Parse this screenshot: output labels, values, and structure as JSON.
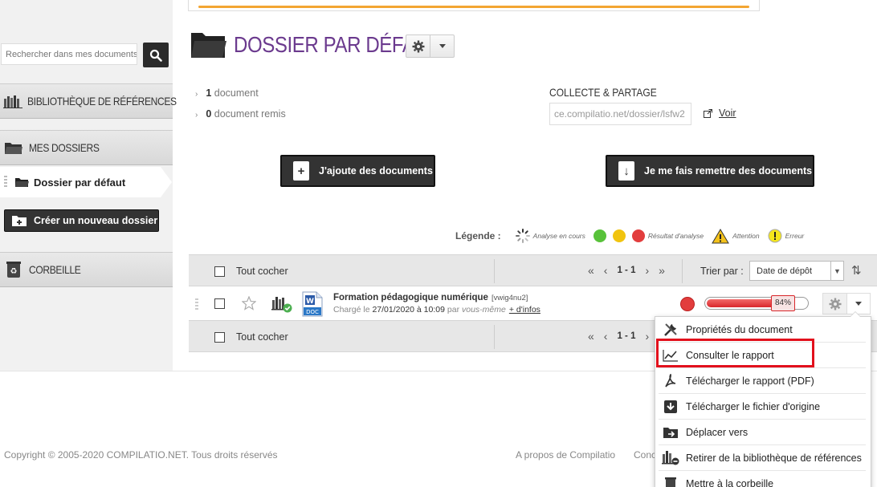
{
  "colors": {
    "title": "#6b3a8e",
    "dark_button": "#333333",
    "red": "#e23d3d",
    "green": "#58c23a",
    "yellow": "#f1c40f",
    "highlight": "#e2101c"
  },
  "sidebar": {
    "search_placeholder": "Rechercher dans mes documents",
    "search_icon": "magnifier-icon",
    "library_label": "Bibliothèque de références",
    "my_folders_label": "Mes dossiers",
    "active_folder_label": "Dossier par défaut",
    "new_folder_label": "Créer un nouveau dossier",
    "trash_label": "Corbeille"
  },
  "header": {
    "title": "DOSSIER PAR DÉFAUT",
    "stats": [
      {
        "count": "1",
        "text": "document"
      },
      {
        "count": "0",
        "text": "document remis"
      }
    ],
    "collect_title": "COLLECTE & PARTAGE",
    "collect_url": "ce.compilatio.net/dossier/lsfw2",
    "voir_label": "Voir"
  },
  "actions": {
    "add_docs": "J'ajoute des documents",
    "request_docs": "Je me fais remettre des documents"
  },
  "legend": {
    "title": "Légende :",
    "analyzing": "Analyse en cours",
    "result": "Résultat d'analyse",
    "warning": "Attention",
    "error": "Erreur"
  },
  "list": {
    "select_all": "Tout cocher",
    "page_range": "1 - 1",
    "sort_label": "Trier par :",
    "sort_value": "Date de dépôt"
  },
  "document": {
    "title": "Formation pédagogique numérique",
    "code": "[vwig4nu2]",
    "loaded_prefix": "Chargé le",
    "date": "27/01/2020 à 10:09",
    "by_prefix": "par",
    "author": "vous-même",
    "more_info": "+ d'infos",
    "file_type": "DOC",
    "similarity_percent": "84%",
    "similarity_fraction": 0.84
  },
  "menu": {
    "items": [
      "Propriétés du document",
      "Consulter le rapport",
      "Télécharger le rapport (PDF)",
      "Télécharger le fichier d'origine",
      "Déplacer vers",
      "Retirer de la bibliothèque de références",
      "Mettre à la corbeille"
    ],
    "highlighted_index": 1
  },
  "footer": {
    "copyright": "Copyright © 2005-2020 COMPILATIO.NET. Tous droits réservés",
    "about": "A propos de Compilatio",
    "cut_link": "Conc"
  }
}
